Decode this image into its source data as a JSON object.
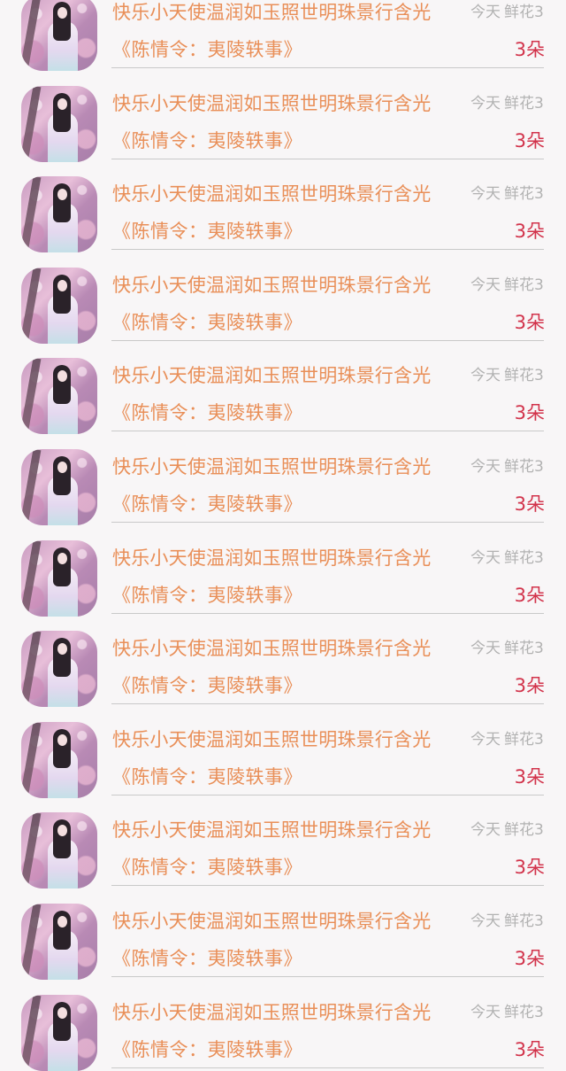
{
  "list": {
    "items": [
      {
        "title": "快乐小天使温润如玉照世明珠景行含光",
        "time": "今天",
        "time_overlap": "鲜花3",
        "subtitle": "《陈情令：夷陵轶事》",
        "count": "3朵"
      },
      {
        "title": "快乐小天使温润如玉照世明珠景行含光",
        "time": "今天",
        "time_overlap": "鲜花3",
        "subtitle": "《陈情令：夷陵轶事》",
        "count": "3朵"
      },
      {
        "title": "快乐小天使温润如玉照世明珠景行含光",
        "time": "今天",
        "time_overlap": "鲜花3",
        "subtitle": "《陈情令：夷陵轶事》",
        "count": "3朵"
      },
      {
        "title": "快乐小天使温润如玉照世明珠景行含光",
        "time": "今天",
        "time_overlap": "鲜花3",
        "subtitle": "《陈情令：夷陵轶事》",
        "count": "3朵"
      },
      {
        "title": "快乐小天使温润如玉照世明珠景行含光",
        "time": "今天",
        "time_overlap": "鲜花3",
        "subtitle": "《陈情令：夷陵轶事》",
        "count": "3朵"
      },
      {
        "title": "快乐小天使温润如玉照世明珠景行含光",
        "time": "今天",
        "time_overlap": "鲜花3",
        "subtitle": "《陈情令：夷陵轶事》",
        "count": "3朵"
      },
      {
        "title": "快乐小天使温润如玉照世明珠景行含光",
        "time": "今天",
        "time_overlap": "鲜花3",
        "subtitle": "《陈情令：夷陵轶事》",
        "count": "3朵"
      },
      {
        "title": "快乐小天使温润如玉照世明珠景行含光",
        "time": "今天",
        "time_overlap": "鲜花3",
        "subtitle": "《陈情令：夷陵轶事》",
        "count": "3朵"
      },
      {
        "title": "快乐小天使温润如玉照世明珠景行含光",
        "time": "今天",
        "time_overlap": "鲜花3",
        "subtitle": "《陈情令：夷陵轶事》",
        "count": "3朵"
      },
      {
        "title": "快乐小天使温润如玉照世明珠景行含光",
        "time": "今天",
        "time_overlap": "鲜花3",
        "subtitle": "《陈情令：夷陵轶事》",
        "count": "3朵"
      },
      {
        "title": "快乐小天使温润如玉照世明珠景行含光",
        "time": "今天",
        "time_overlap": "鲜花3",
        "subtitle": "《陈情令：夷陵轶事》",
        "count": "3朵"
      },
      {
        "title": "快乐小天使温润如玉照世明珠景行含光",
        "time": "今天",
        "time_overlap": "鲜花3",
        "subtitle": "《陈情令：夷陵轶事》",
        "count": "3朵"
      }
    ]
  },
  "colors": {
    "background": "#f8f6f7",
    "title": "#e98f58",
    "count": "#d2334b",
    "time": "#b2b2b2",
    "divider": "#c9c9c9"
  }
}
